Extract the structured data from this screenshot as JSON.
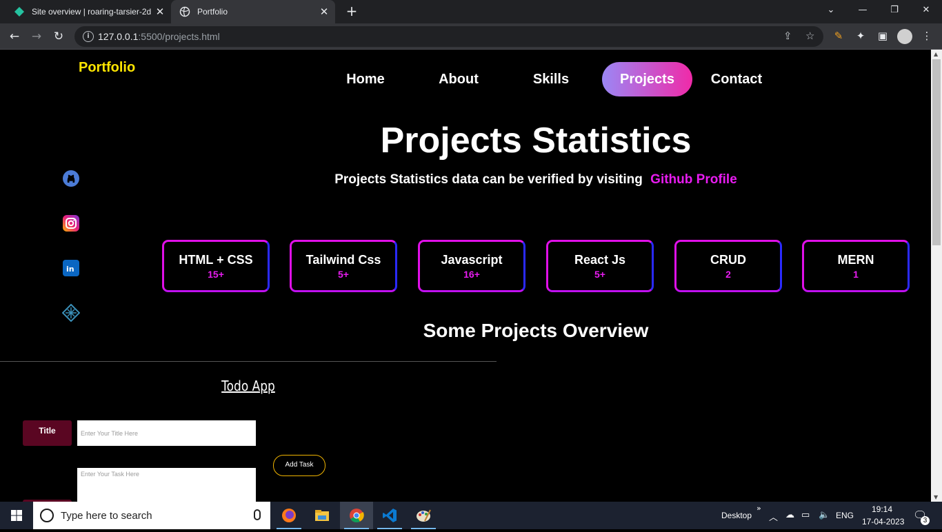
{
  "browser": {
    "tabs": [
      {
        "title": "Site overview | roaring-tarsier-2d",
        "favicon": "netlify-diamond-icon",
        "state": "inactive"
      },
      {
        "title": "Portfolio",
        "favicon": "globe-icon",
        "state": "active"
      }
    ],
    "url_host": "127.0.0.1",
    "url_rest": ":5500/projects.html"
  },
  "page": {
    "logo": "Portfolio",
    "nav": [
      {
        "label": "Home",
        "active": false
      },
      {
        "label": "About",
        "active": false
      },
      {
        "label": "Skills",
        "active": false
      },
      {
        "label": "Projects",
        "active": true
      },
      {
        "label": "Contact",
        "active": false
      }
    ],
    "social": [
      "github-icon",
      "instagram-icon",
      "linkedin-icon",
      "netlify-icon"
    ],
    "heading": "Projects Statistics",
    "subheading": "Projects Statistics data can be verified by visiting",
    "subheading_link": "Github Profile",
    "stats": [
      {
        "name": "HTML + CSS",
        "count": "15+"
      },
      {
        "name": "Tailwind Css",
        "count": "5+"
      },
      {
        "name": "Javascript",
        "count": "16+"
      },
      {
        "name": "React Js",
        "count": "5+"
      },
      {
        "name": "CRUD",
        "count": "2"
      },
      {
        "name": "MERN",
        "count": "1"
      }
    ],
    "overview_heading": "Some Projects Overview",
    "todo": {
      "title": "Todo App",
      "title_label": "Title",
      "title_placeholder": "Enter Your Title Here",
      "task_placeholder": "Enter Your Task Here",
      "add_button": "Add Task"
    }
  },
  "colors": {
    "logo": "#ffe600",
    "accent": "#e81cf0",
    "nav_active_start": "#9b87f5",
    "nav_active_end": "#f02aa8",
    "label_bg": "#5a0622",
    "button_border": "#f0b400"
  },
  "taskbar": {
    "search_placeholder": "Type here to search",
    "desktop_label": "Desktop",
    "language": "ENG",
    "time": "19:14",
    "date": "17-04-2023",
    "notifications": "3"
  }
}
